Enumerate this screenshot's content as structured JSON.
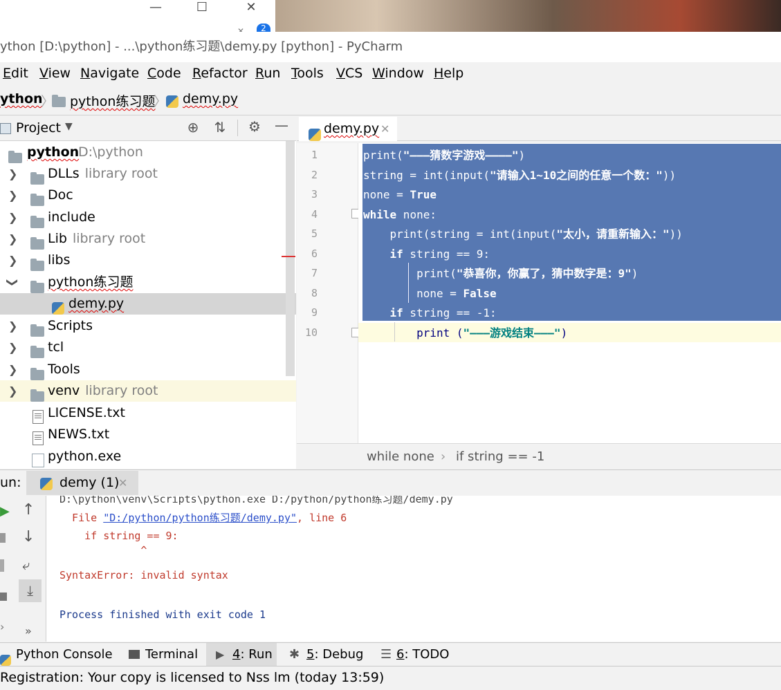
{
  "window": {
    "title": "ython [D:\\python] - ...\\python练习题\\demy.py [python] - PyCharm",
    "badge": "2"
  },
  "menu": [
    "Edit",
    "View",
    "Navigate",
    "Code",
    "Refactor",
    "Run",
    "Tools",
    "VCS",
    "Window",
    "Help"
  ],
  "navbar": {
    "project": "ython",
    "folder": "python练习题",
    "file": "demy.py"
  },
  "project_panel": {
    "title": "Project",
    "root": {
      "name": "python",
      "path": "D:\\python"
    },
    "items": [
      {
        "name": "DLLs",
        "suffix": "library root"
      },
      {
        "name": "Doc",
        "suffix": ""
      },
      {
        "name": "include",
        "suffix": ""
      },
      {
        "name": "Lib",
        "suffix": "library root"
      },
      {
        "name": "libs",
        "suffix": ""
      },
      {
        "name": "python练习题",
        "suffix": ""
      },
      {
        "name": "demy.py",
        "suffix": ""
      },
      {
        "name": "Scripts",
        "suffix": ""
      },
      {
        "name": "tcl",
        "suffix": ""
      },
      {
        "name": "Tools",
        "suffix": ""
      },
      {
        "name": "venv",
        "suffix": "library root"
      },
      {
        "name": "LICENSE.txt",
        "suffix": ""
      },
      {
        "name": "NEWS.txt",
        "suffix": ""
      },
      {
        "name": "python.exe",
        "suffix": ""
      }
    ]
  },
  "editor": {
    "tab": "demy.py",
    "line_numbers": [
      "1",
      "2",
      "3",
      "4",
      "5",
      "6",
      "7",
      "8",
      "9",
      "10"
    ],
    "lines": [
      {
        "a": "print(",
        "b": "\"———猜数字游戏————\"",
        "c": ")"
      },
      {
        "a": "string = int(input(",
        "b": "\"请输入1~10之间的任意一个数：\"",
        "c": "))"
      },
      {
        "a": "none = ",
        "b": "True",
        "c": ""
      },
      {
        "a": "while",
        "b": " none:",
        "c": ""
      },
      {
        "a": "    print(string = int(input(",
        "b": "\"太小，请重新输入：\"",
        "c": "))"
      },
      {
        "a": "    if",
        "b": " string == 9:",
        "c": ""
      },
      {
        "a": "        print(",
        "b": "\"恭喜你，你赢了，猜中数字是：9\"",
        "c": ")"
      },
      {
        "a": "        none = ",
        "b": "False",
        "c": ""
      },
      {
        "a": "    if",
        "b": " string == -1:",
        "c": ""
      },
      {
        "a": "        print (",
        "b": "\"———游戏结束———\"",
        "c": ")"
      }
    ],
    "breadcrumb": [
      "while none",
      "if string == -1"
    ]
  },
  "run": {
    "label": "un:",
    "tab": "demy (1)",
    "output": {
      "cmd": "D:\\python\\venv\\Scripts\\python.exe D:/python/python练习题/demy.py",
      "file_prefix": "  File ",
      "file_link": "\"D:/python/python练习题/demy.py\"",
      "file_suffix": ", line 6",
      "code": "    if string == 9:",
      "caret": "             ^",
      "error": "SyntaxError: invalid syntax",
      "exit": "Process finished with exit code 1"
    }
  },
  "bottom_tabs": [
    {
      "num": "",
      "label": "Python Console"
    },
    {
      "num": "",
      "label": "Terminal"
    },
    {
      "num": "4",
      "label": ": Run"
    },
    {
      "num": "5",
      "label": ": Debug"
    },
    {
      "num": "6",
      "label": ": TODO"
    }
  ],
  "status": "Registration: Your copy is licensed to Nss lm (today 13:59)"
}
